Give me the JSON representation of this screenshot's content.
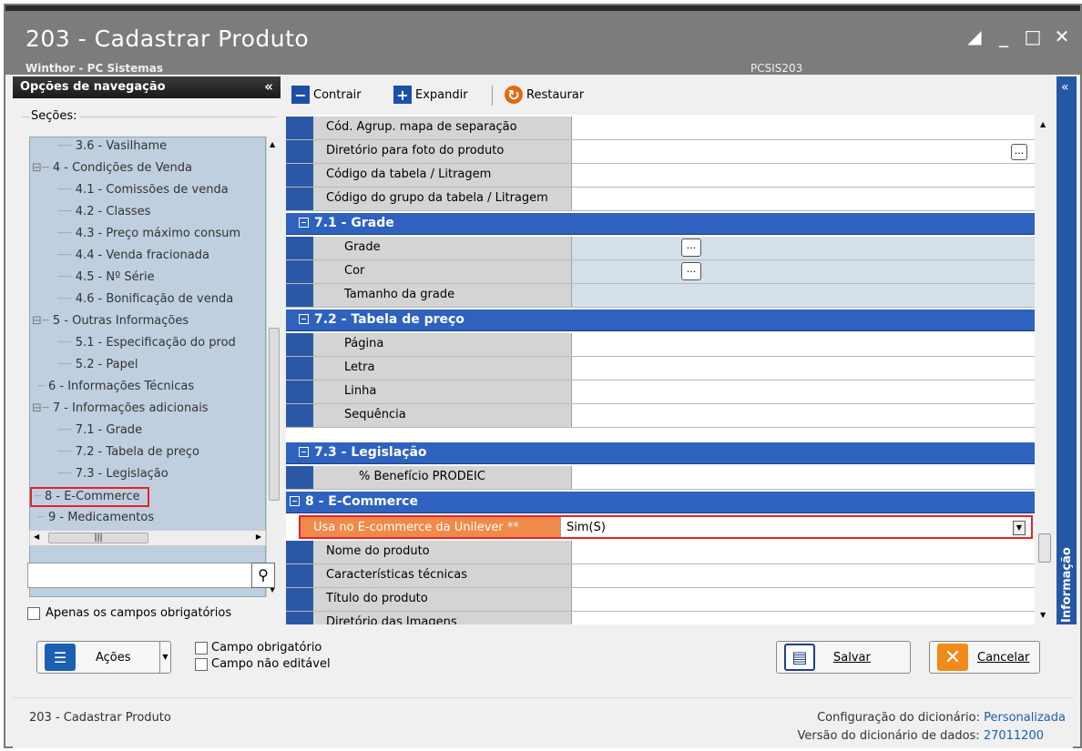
{
  "window": {
    "title": "203 - Cadastrar  Produto",
    "subtitle": "Winthor - PC Sistemas",
    "code": "PCSIS203",
    "controls": [
      "restore",
      "minimize",
      "maximize",
      "close"
    ]
  },
  "nav": {
    "header": "Opções de navegação",
    "collapse": "«",
    "sections_label": "Seções:",
    "items": [
      "3.6 - Vasilhame",
      "4 - Condições de Venda",
      "4.1 - Comissões de venda",
      "4.2 - Classes",
      "4.3 - Preço máximo consum",
      "4.4 - Venda fracionada",
      "4.5 - Nº Série",
      "4.6 - Bonificação de venda",
      "5 - Outras Informações",
      "5.1 - Especificação do prod",
      "5.2 - Papel",
      "6 - Informações Técnicas",
      "7 - Informações adicionais",
      "7.1 - Grade",
      "7.2 - Tabela de preço",
      "7.3 - Legislação",
      "8 - E-Commerce",
      "9 - Medicamentos"
    ],
    "selected": "8 - E-Commerce",
    "search_value": "",
    "only_required_label": "Apenas os campos obrigatórios"
  },
  "toolbar": {
    "collapse_label": "Contrair",
    "expand_label": "Expandir",
    "restore_label": "Restaurar"
  },
  "grid": {
    "top_rows": [
      "Cód. Agrup. mapa de separação",
      "Diretório para foto do produto",
      "Código da tabela / Litragem",
      "Código do grupo da tabela / Litragem"
    ],
    "group_grade": "7.1 - Grade",
    "grade_rows": [
      "Grade",
      "Cor",
      "Tamanho da grade"
    ],
    "group_preco": "7.2 - Tabela de preço",
    "preco_rows": [
      "Página",
      "Letra",
      "Linha",
      "Sequência"
    ],
    "group_leg": "7.3 - Legislação",
    "leg_rows": [
      "% Benefício PRODEIC"
    ],
    "group_ecom": "8 - E-Commerce",
    "ecom_highlight_label": "Usa no E-commerce da Unilever **",
    "ecom_highlight_value": "Sim(S)",
    "ecom_rows": [
      "Nome do produto",
      "Características técnicas",
      "Título do produto",
      "Diretório das Imagens"
    ],
    "ellipsis": "..."
  },
  "side_tab": {
    "label": "Informação",
    "collapse": "«"
  },
  "bottom": {
    "actions_label": "Ações",
    "legend_required": "Campo obrigatório",
    "legend_noneditable": "Campo não editável",
    "save_label": "Salvar",
    "cancel_label": "Cancelar"
  },
  "status": {
    "left": "203 - Cadastrar  Produto",
    "config_label": "Configuração do dicionário:",
    "config_value": "Personalizada",
    "version_label": "Versão do dicionário de dados:",
    "version_value": "27011200"
  },
  "colors": {
    "group_header": "#2e62be",
    "highlight_label": "#f08a4a",
    "highlight_border": "#e8202a",
    "cancel_icon": "#f08a1a",
    "save_icon": "#1d3f8a"
  }
}
